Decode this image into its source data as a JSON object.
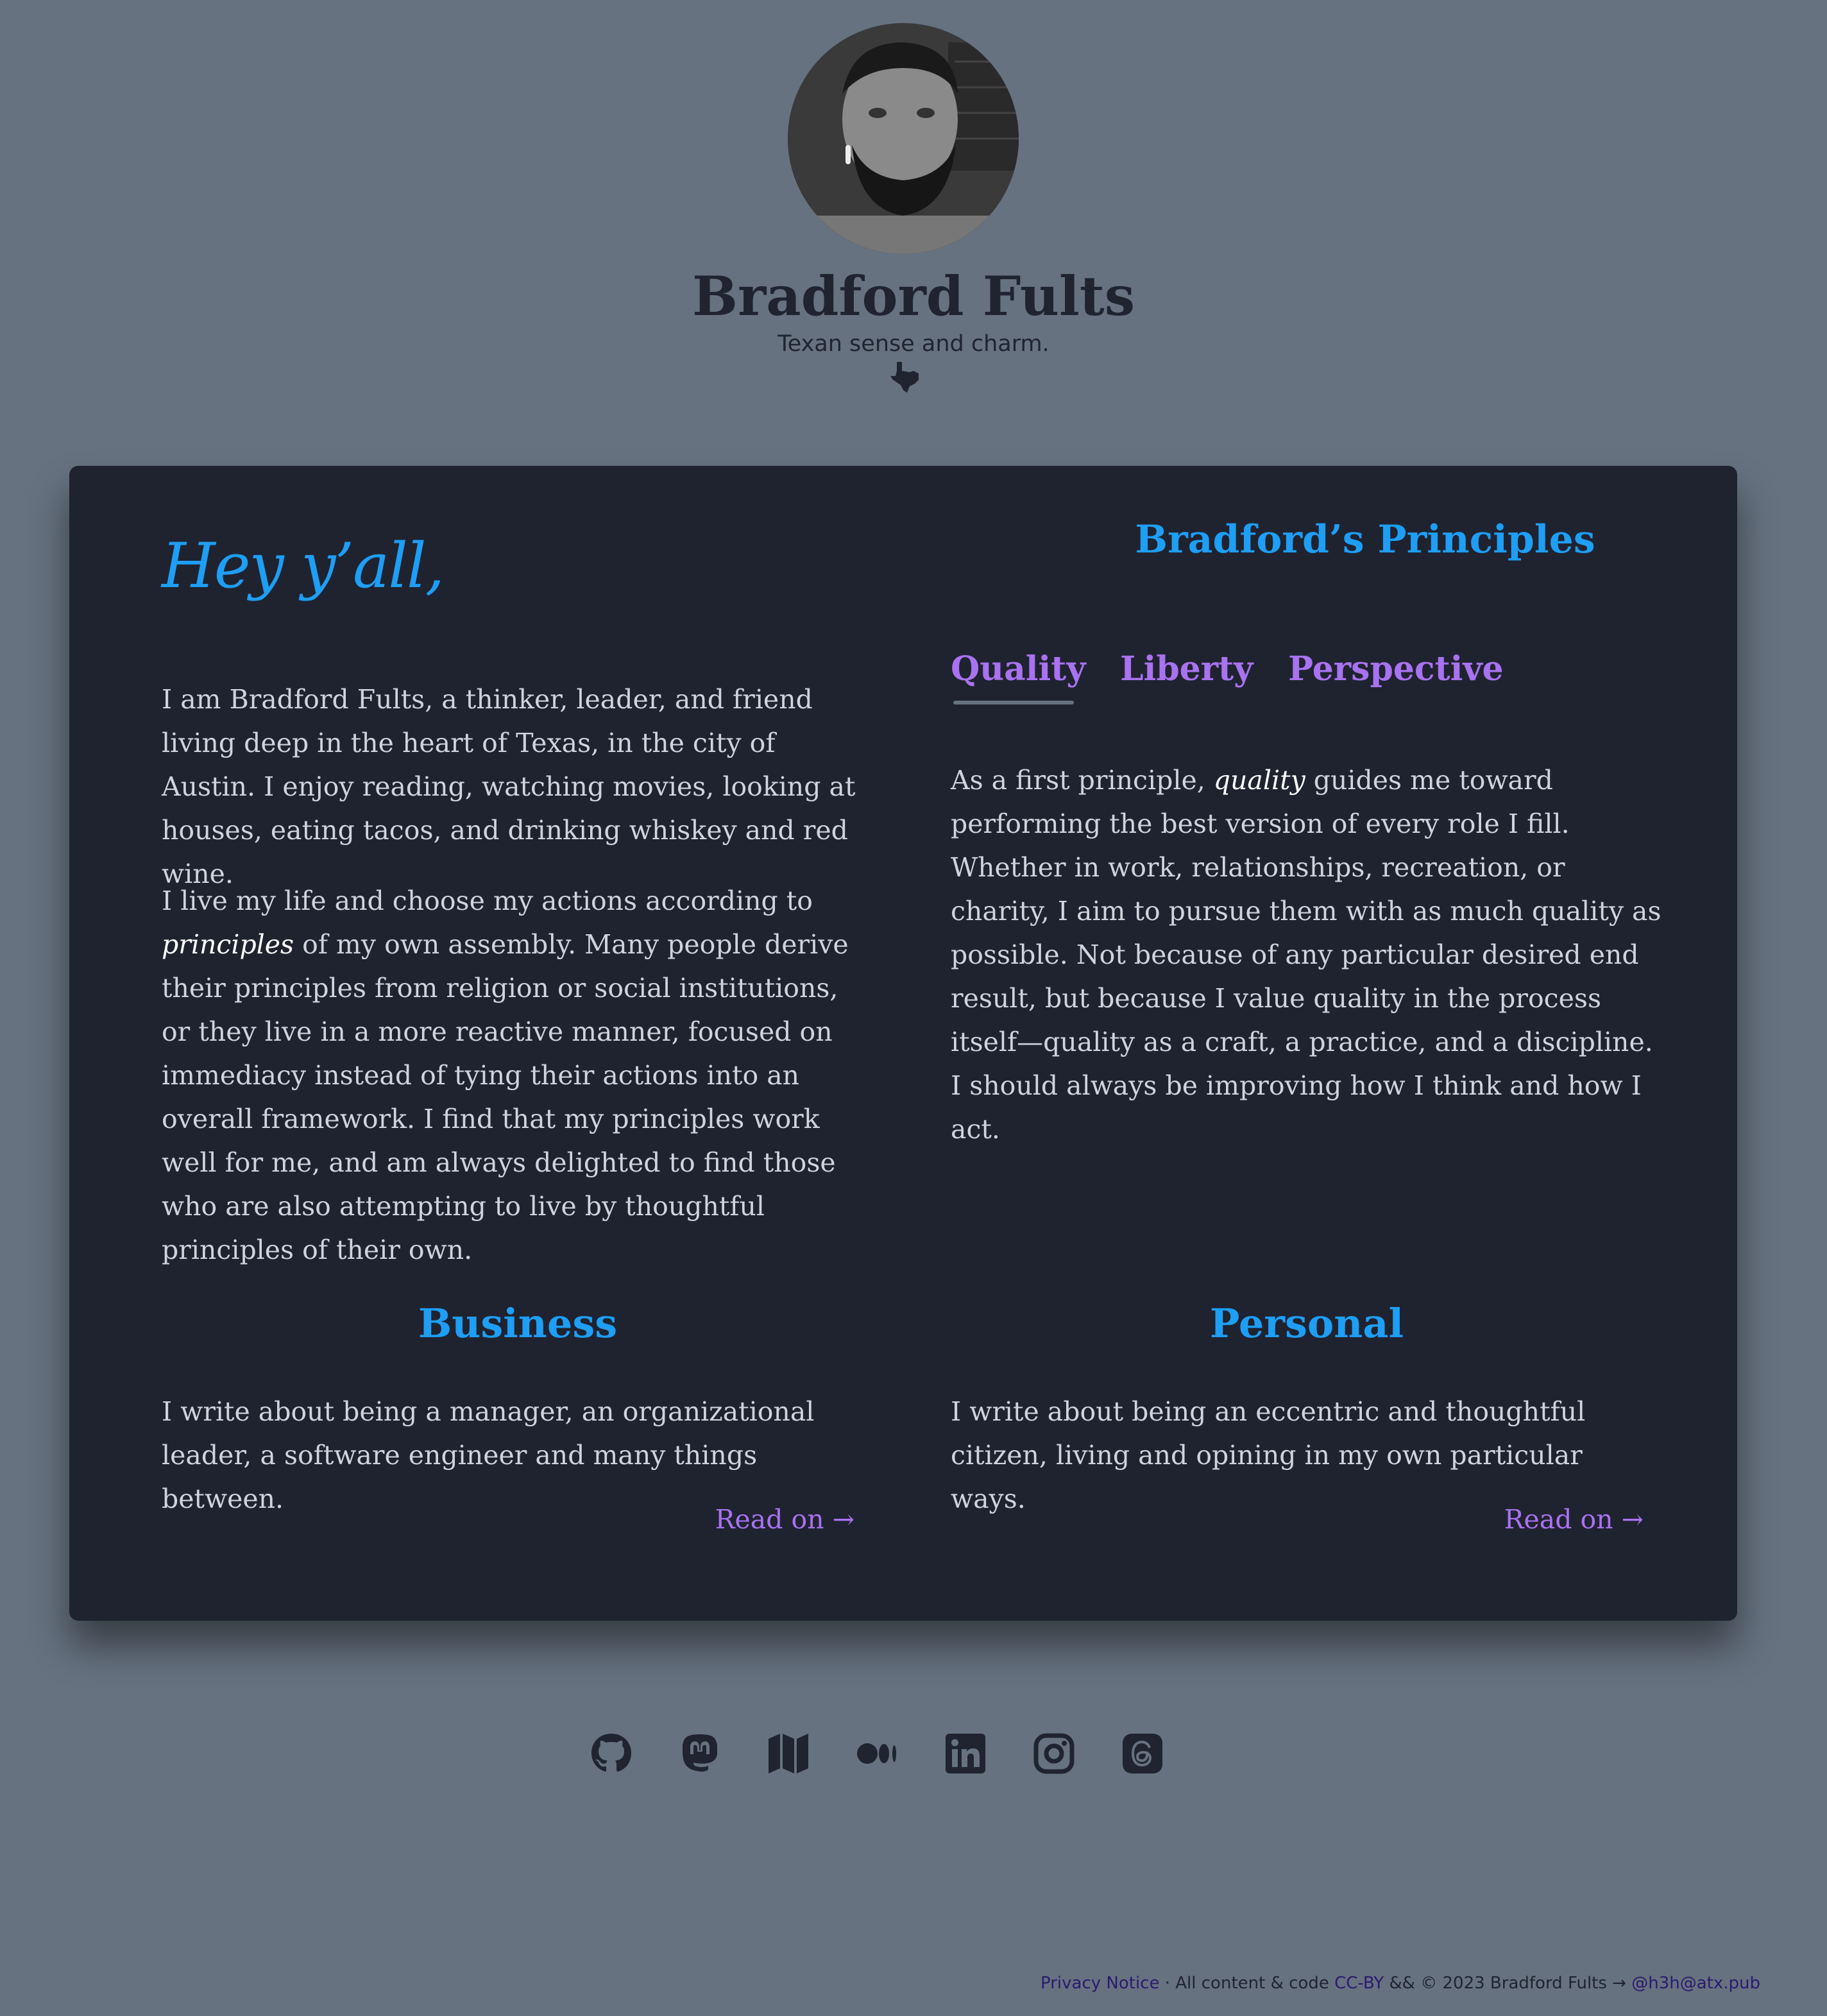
{
  "header": {
    "title": "Bradford Fults",
    "tagline": "Texan sense and charm."
  },
  "intro": {
    "greeting": "Hey y’all,",
    "p1": "I am Bradford Fults, a thinker, leader, and friend living deep in the heart of Texas, in the city of Austin. I enjoy reading, watching movies, looking at houses, eating tacos, and drinking whiskey and red wine.",
    "p2_em": "principles",
    "p2_before": "I live my life and choose my actions according to ",
    "p2_after": " of my own assembly. Many people derive their principles from religion or social institutions, or they live in a more reactive manner, focused on immediacy instead of tying their actions into an overall framework. I find that my principles work well for me, and am always delighted to find those who are also attempting to live by thoughtful principles of their own."
  },
  "principles": {
    "title": "Bradford’s Principles",
    "tabs": [
      {
        "label": "Quality",
        "active": true
      },
      {
        "label": "Liberty",
        "active": false
      },
      {
        "label": "Perspective",
        "active": false
      }
    ],
    "body_before": "As a first principle, ",
    "body_em": "quality",
    "body_after": " guides me toward performing the best version of every role I fill. Whether in work, relationships, recreation, or charity, I aim to pursue them with as much quality as possible. Not because of any particular desired end result, but because I value quality in the process itself—quality as a craft, a practice, and a discipline. I should always be improving how I think and how I act."
  },
  "sections": [
    {
      "title": "Business",
      "body": "I write about being a manager, an organizational leader, a software engineer and many things between.",
      "link": "Read on →"
    },
    {
      "title": "Personal",
      "body": "I write about being an eccentric and thoughtful citizen, living and opining in my own particular ways.",
      "link": "Read on →"
    }
  ],
  "social_icons": [
    "github-icon",
    "mastodon-icon",
    "map-icon",
    "medium-icon",
    "linkedin-icon",
    "instagram-icon",
    "threads-icon"
  ],
  "footer": {
    "privacy": "Privacy Notice",
    "text1": " · All content & code ",
    "license": "CC-BY",
    "text2": " && © 2023 Bradford Fults → ",
    "handle": "@h3h@atx.pub"
  },
  "colors": {
    "background": "#667280",
    "card": "#1f2330",
    "heading_blue": "#1e9ef5",
    "link_purple": "#a972f0",
    "text": "#cfd3dc"
  }
}
